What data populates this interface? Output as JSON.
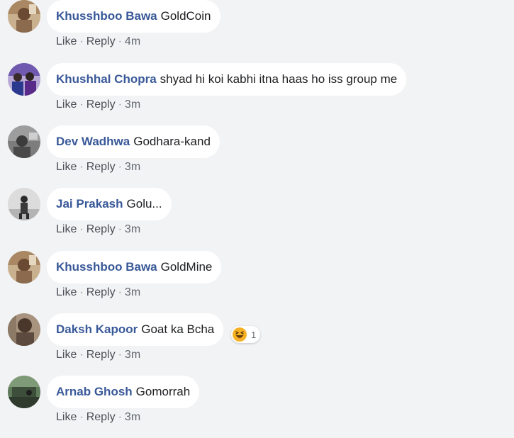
{
  "comments": [
    {
      "author": "Khusshboo Bawa",
      "text": "GoldCoin",
      "actions": {
        "like": "Like",
        "reply": "Reply",
        "time": "4m"
      }
    },
    {
      "author": "Khushhal Chopra",
      "text": "shyad hi koi kabhi itna haas ho iss group me",
      "actions": {
        "like": "Like",
        "reply": "Reply",
        "time": "3m"
      }
    },
    {
      "author": "Dev Wadhwa",
      "text": "Godhara-kand",
      "actions": {
        "like": "Like",
        "reply": "Reply",
        "time": "3m"
      }
    },
    {
      "author": "Jai Prakash",
      "text": "Golu...",
      "actions": {
        "like": "Like",
        "reply": "Reply",
        "time": "3m"
      }
    },
    {
      "author": "Khusshboo Bawa",
      "text": "GoldMine",
      "actions": {
        "like": "Like",
        "reply": "Reply",
        "time": "3m"
      }
    },
    {
      "author": "Daksh Kapoor",
      "text": "Goat ka Bcha",
      "reaction": {
        "icon": "haha-icon",
        "count": "1"
      },
      "actions": {
        "like": "Like",
        "reply": "Reply",
        "time": "3m"
      }
    },
    {
      "author": "Arnab Ghosh",
      "text": "Gomorrah",
      "actions": {
        "like": "Like",
        "reply": "Reply",
        "time": "3m"
      }
    }
  ],
  "separator": "·",
  "colors": {
    "background": "#f2f3f5",
    "bubble": "#ffffff",
    "author": "#385898",
    "text": "#1c1e21",
    "meta": "#616770",
    "haha": "#f7b125"
  }
}
